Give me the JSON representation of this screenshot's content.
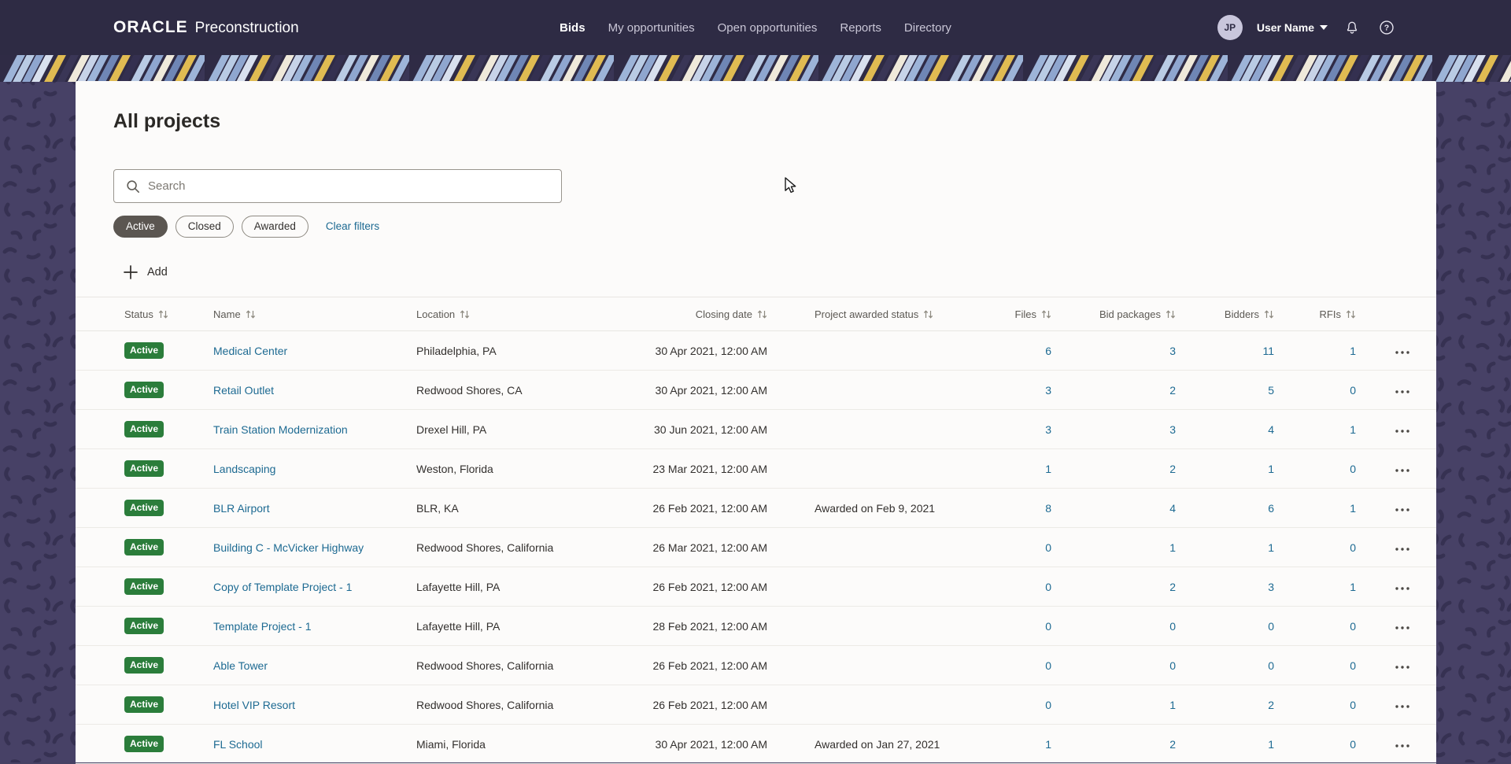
{
  "header": {
    "brand": {
      "logo_text": "ORACLE",
      "product_name": "Preconstruction"
    },
    "nav_items": [
      {
        "label": "Bids",
        "active": true
      },
      {
        "label": "My opportunities",
        "active": false
      },
      {
        "label": "Open opportunities",
        "active": false
      },
      {
        "label": "Reports",
        "active": false
      },
      {
        "label": "Directory",
        "active": false
      }
    ],
    "user": {
      "initials": "JP",
      "display_name": "User Name"
    },
    "icons": {
      "notifications": "bell-icon",
      "help": "help-icon",
      "user_menu": "chevron-down-icon"
    }
  },
  "page": {
    "title": "All projects",
    "search": {
      "placeholder": "Search",
      "value": "",
      "icon": "search-icon"
    },
    "filters": {
      "chips": [
        {
          "label": "Active",
          "selected": true
        },
        {
          "label": "Closed",
          "selected": false
        },
        {
          "label": "Awarded",
          "selected": false
        }
      ],
      "clear_label": "Clear filters"
    },
    "add_button_label": "Add"
  },
  "table": {
    "columns": [
      {
        "key": "status",
        "label": "Status"
      },
      {
        "key": "name",
        "label": "Name"
      },
      {
        "key": "location",
        "label": "Location"
      },
      {
        "key": "closing-date",
        "label": "Closing date"
      },
      {
        "key": "project-awarded-status",
        "label": "Project awarded status"
      },
      {
        "key": "files",
        "label": "Files"
      },
      {
        "key": "bid-packages",
        "label": "Bid packages"
      },
      {
        "key": "bidders",
        "label": "Bidders"
      },
      {
        "key": "rfis",
        "label": "RFIs"
      }
    ],
    "rows": [
      {
        "status": "Active",
        "name": "Medical Center",
        "location": "Philadelphia, PA",
        "closing_date": "30 Apr 2021, 12:00 AM",
        "awarded_status": "",
        "files": "6",
        "bid_packages": "3",
        "bidders": "11",
        "rfis": "1"
      },
      {
        "status": "Active",
        "name": "Retail Outlet",
        "location": "Redwood Shores, CA",
        "closing_date": "30 Apr 2021, 12:00 AM",
        "awarded_status": "",
        "files": "3",
        "bid_packages": "2",
        "bidders": "5",
        "rfis": "0"
      },
      {
        "status": "Active",
        "name": "Train Station Modernization",
        "location": "Drexel Hill, PA",
        "closing_date": "30 Jun 2021, 12:00 AM",
        "awarded_status": "",
        "files": "3",
        "bid_packages": "3",
        "bidders": "4",
        "rfis": "1"
      },
      {
        "status": "Active",
        "name": "Landscaping",
        "location": "Weston, Florida",
        "closing_date": "23 Mar 2021, 12:00 AM",
        "awarded_status": "",
        "files": "1",
        "bid_packages": "2",
        "bidders": "1",
        "rfis": "0"
      },
      {
        "status": "Active",
        "name": "BLR Airport",
        "location": "BLR, KA",
        "closing_date": "26 Feb 2021, 12:00 AM",
        "awarded_status": "Awarded on Feb 9, 2021",
        "files": "8",
        "bid_packages": "4",
        "bidders": "6",
        "rfis": "1"
      },
      {
        "status": "Active",
        "name": "Building C - McVicker Highway",
        "location": "Redwood Shores, California",
        "closing_date": "26 Mar 2021, 12:00 AM",
        "awarded_status": "",
        "files": "0",
        "bid_packages": "1",
        "bidders": "1",
        "rfis": "0"
      },
      {
        "status": "Active",
        "name": "Copy of Template Project - 1",
        "location": "Lafayette Hill, PA",
        "closing_date": "26 Feb 2021, 12:00 AM",
        "awarded_status": "",
        "files": "0",
        "bid_packages": "2",
        "bidders": "3",
        "rfis": "1"
      },
      {
        "status": "Active",
        "name": "Template Project - 1",
        "location": "Lafayette Hill, PA",
        "closing_date": "28 Feb 2021, 12:00 AM",
        "awarded_status": "",
        "files": "0",
        "bid_packages": "0",
        "bidders": "0",
        "rfis": "0"
      },
      {
        "status": "Active",
        "name": "Able Tower",
        "location": "Redwood Shores, California",
        "closing_date": "26 Feb 2021, 12:00 AM",
        "awarded_status": "",
        "files": "0",
        "bid_packages": "0",
        "bidders": "0",
        "rfis": "0"
      },
      {
        "status": "Active",
        "name": "Hotel VIP Resort",
        "location": "Redwood Shores, California",
        "closing_date": "26 Feb 2021, 12:00 AM",
        "awarded_status": "",
        "files": "0",
        "bid_packages": "1",
        "bidders": "2",
        "rfis": "0"
      },
      {
        "status": "Active",
        "name": "FL School",
        "location": "Miami, Florida",
        "closing_date": "30 Apr 2021, 12:00 AM",
        "awarded_status": "Awarded on Jan 27, 2021",
        "files": "1",
        "bid_packages": "2",
        "bidders": "1",
        "rfis": "0"
      }
    ]
  },
  "colors": {
    "header_bg": "#2e2b44",
    "page_bg": "#464163",
    "card_bg": "#fcfbfa",
    "link": "#1d6a92",
    "status_active_bg": "#2b7d3b",
    "chip_selected_bg": "#5b5651",
    "band_yellow": "#e0bb52",
    "band_light_blue": "#9db4d8"
  }
}
